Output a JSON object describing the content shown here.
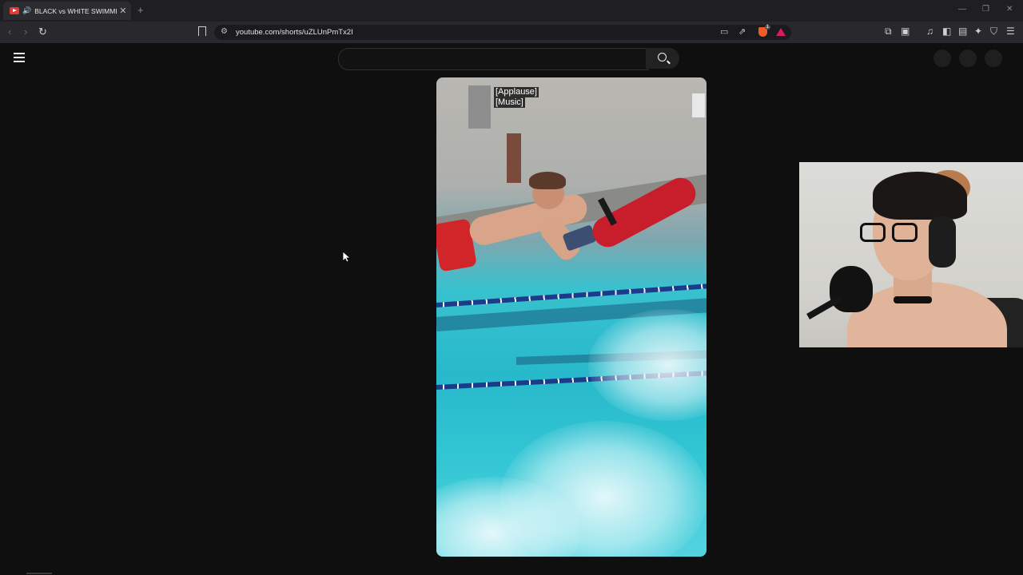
{
  "browser": {
    "tab": {
      "title": "BLACK vs WHITE SWIMMING",
      "audio_icon": "speaker-icon",
      "close_symbol": "✕"
    },
    "new_tab_symbol": "+",
    "window_controls": [
      "—",
      "❐",
      "✕"
    ],
    "nav": {
      "back": "‹",
      "forward": "›",
      "reload": "↻"
    },
    "address": {
      "url": "youtube.com/shorts/uZLUnPmTx2I",
      "site_settings_icon": "tune-icon"
    },
    "extension_icons": [
      "puzzle-icon",
      "tab-search-icon",
      "music-icon",
      "sidebar-icon",
      "wallet-icon",
      "leo-icon",
      "vpn-shield-icon",
      "menu-icon"
    ],
    "brave_shield_badge": "1"
  },
  "youtube": {
    "search": {
      "value": "",
      "placeholder": ""
    },
    "captions": [
      "[Applause]",
      "[Music]"
    ]
  },
  "colors": {
    "page_bg": "#0f0f0f",
    "tab_strip_bg": "#1f1f23",
    "toolbar_bg": "#28282d",
    "youtube_red": "#e53935",
    "brave_orange": "#f25a28"
  }
}
